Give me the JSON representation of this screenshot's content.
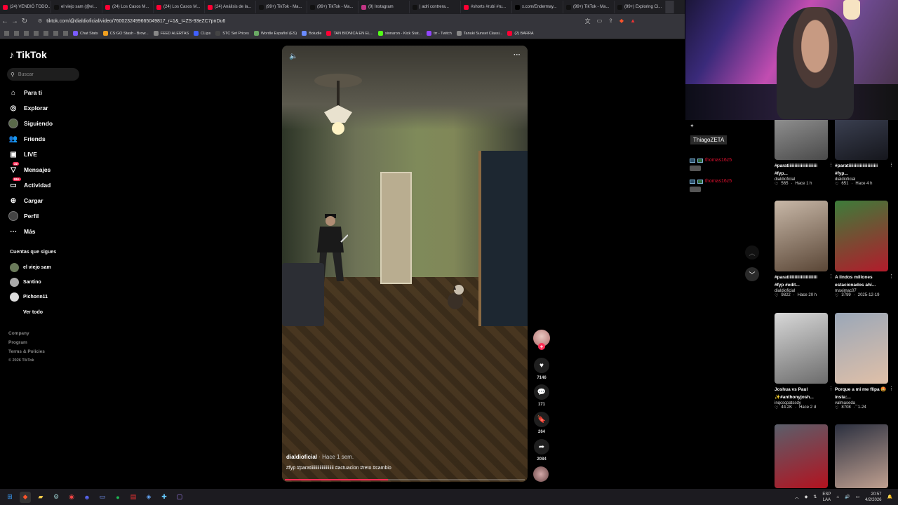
{
  "browser": {
    "tabs": [
      {
        "label": "(24) VENDIÓ TODO...",
        "color": "#ff0033"
      },
      {
        "label": "el viejo sam (@el...",
        "color": "#111111"
      },
      {
        "label": "(24) Los Casos M...",
        "color": "#ff0033"
      },
      {
        "label": "(24) Los Casos M...",
        "color": "#ff0033"
      },
      {
        "label": "(24) Análisis de la...",
        "color": "#ff0033"
      },
      {
        "label": "(99+) TikTok - Ma...",
        "color": "#111111"
      },
      {
        "label": "(99+) TikTok - Ma...",
        "color": "#111111"
      },
      {
        "label": "(9) Instagram",
        "color": "#c13584"
      },
      {
        "label": "| adri contrera...",
        "color": "#111111"
      },
      {
        "label": "#shorts #rubi #ru...",
        "color": "#ff0033"
      },
      {
        "label": "x.com/Endermay...",
        "color": "#000000"
      },
      {
        "label": "(99+) TikTok - Ma...",
        "color": "#111111"
      },
      {
        "label": "(99+) Exploring Ci...",
        "color": "#111111"
      }
    ],
    "url": "tiktok.com/@dialdioficial/video/7600232499665049817_r=1&_t=ZS-93eZC7pnDu6",
    "bookmarks": [
      {
        "label": "Chat Stats",
        "color": "#7a5cff"
      },
      {
        "label": "CS:GO Stash - Brow...",
        "color": "#f0a020"
      },
      {
        "label": "FEED ALERTAS",
        "color": "#888888"
      },
      {
        "label": "CLips",
        "color": "#4060ff"
      },
      {
        "label": "STC Set Prices",
        "color": "#444444"
      },
      {
        "label": "Wordle Español (ES)",
        "color": "#6aaa64"
      },
      {
        "label": "Boludle",
        "color": "#6a8bff"
      },
      {
        "label": "TAN BIONICA EN EL...",
        "color": "#ff0033"
      },
      {
        "label": "sionaron - Kick Stat...",
        "color": "#53fc18"
      },
      {
        "label": "trr - Twitch",
        "color": "#9146ff"
      },
      {
        "label": "Tanuki Sunset Classi...",
        "color": "#888888"
      },
      {
        "label": "(2) BARRA",
        "color": "#ff0033"
      }
    ]
  },
  "sidebar": {
    "logo": "TikTok",
    "search_placeholder": "Buscar",
    "nav": [
      {
        "label": "Para ti",
        "icon": "home-icon",
        "glyph": "⌂"
      },
      {
        "label": "Explorar",
        "icon": "compass-icon",
        "glyph": "◎"
      },
      {
        "label": "Siguiendo",
        "icon": "following-avatar-icon",
        "glyph": "●"
      },
      {
        "label": "Friends",
        "icon": "friends-icon",
        "glyph": "👥"
      },
      {
        "label": "LIVE",
        "icon": "live-icon",
        "glyph": "▣"
      },
      {
        "label": "Mensajes",
        "icon": "messages-icon",
        "glyph": "▽",
        "badge": "32"
      },
      {
        "label": "Actividad",
        "icon": "activity-icon",
        "glyph": "▭",
        "badge": "99+"
      },
      {
        "label": "Cargar",
        "icon": "upload-icon",
        "glyph": "⊕"
      },
      {
        "label": "Perfil",
        "icon": "profile-icon",
        "glyph": "●"
      },
      {
        "label": "Más",
        "icon": "more-icon",
        "glyph": "⋯"
      }
    ],
    "following_title": "Cuentas que sigues",
    "following": [
      {
        "name": "el viejo sam"
      },
      {
        "name": "Santino"
      },
      {
        "name": "Pichonn11"
      }
    ],
    "see_all": "Ver todo",
    "footer": [
      "Company",
      "Program",
      "Terms & Policies",
      "© 2026 TikTok"
    ]
  },
  "video": {
    "author": "dialdioficial",
    "time": "· Hace 1 sem.",
    "hashtags": "#fyp #paratiiiiiiiiiiiiiiiiiiiii #actuacion #reto #cambio",
    "progress": 0.43,
    "likes": "7146",
    "comments": "171",
    "saves": "264",
    "shares": "2084"
  },
  "chat": {
    "streamer_name": "ThiagoZETA",
    "messages": [
      {
        "user": "thomas16z5"
      },
      {
        "user": "thomas16z5"
      }
    ]
  },
  "recommended": [
    {
      "title": "#paratiiiiiiiiiiiiiiiiiiiiiii #fyp...",
      "author": "dialdioficial",
      "views": "565",
      "time": "Hace 1 h",
      "c1": "#8e8e8e",
      "c2": "#4a4a4a"
    },
    {
      "title": "#paratiiiiiiiiiiiiiiiiiiiiiii #fyp...",
      "author": "dialdioficial",
      "views": "651",
      "time": "Hace 4 h",
      "c1": "#3a3f50",
      "c2": "#15161c"
    },
    {
      "title": "#paratiiiiiiiiiiiiiiiiiiiiiii #fyp #edit...",
      "author": "dialdioficial",
      "views": "9822",
      "time": "Hace 20 h",
      "c1": "#c8b8a8",
      "c2": "#5a4636"
    },
    {
      "title": "A lindos millones estacionados ahí...",
      "author": "maximac07",
      "views": "3799",
      "time": "2025-12-19",
      "c1": "#3c7d3a",
      "c2": "#b31b2b"
    },
    {
      "title": "Joshua vs Paul ✨#anthonyjosh...",
      "author": "inqcscpatssdy",
      "views": "44.2K",
      "time": "Hace 2 d",
      "c1": "#d8d8d8",
      "c2": "#6c6c6c"
    },
    {
      "title": "Porque a mi me flipa 🤩 insta:...",
      "author": "valmaseda_",
      "views": "8708",
      "time": "1-24",
      "c1": "#9aa7b8",
      "c2": "#e0c0a8"
    },
    {
      "title": "",
      "author": "",
      "views": "",
      "time": "",
      "c1": "#5a5f6b",
      "c2": "#b3121f"
    },
    {
      "title": "",
      "author": "",
      "views": "",
      "time": "",
      "c1": "#2b3040",
      "c2": "#c0a090"
    }
  ],
  "taskbar": {
    "lang": "ESP",
    "lang2": "LAA",
    "time": "20:57",
    "date": "4/2/2026"
  }
}
